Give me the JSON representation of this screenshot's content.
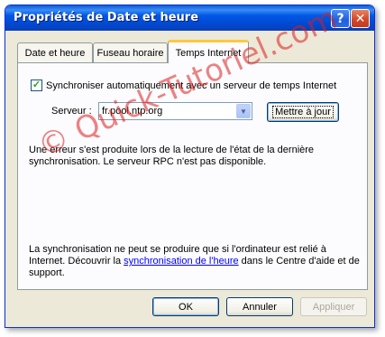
{
  "window": {
    "title": "Propriétés de Date et heure",
    "help_glyph": "?",
    "close_glyph": "✕"
  },
  "tabs": [
    {
      "label": "Date et heure"
    },
    {
      "label": "Fuseau horaire"
    },
    {
      "label": "Temps Internet"
    }
  ],
  "internet_time": {
    "sync_checkbox_label": "Synchroniser automatiquement avec un serveur de temps Internet",
    "sync_checked": true,
    "check_glyph": "✓",
    "server_label": "Serveur :",
    "server_value": "fr.pool.ntp.org",
    "dropdown_glyph": "▼",
    "update_button": "Mettre à jour",
    "error_text": "Une erreur s'est produite lors de la lecture de l'état de la dernière synchronisation. Le serveur RPC n'est pas disponible.",
    "info_before": "La synchronisation ne peut se produire que si l'ordinateur est relié à Internet. Découvrir la ",
    "info_link": "synchronisation de l'heure",
    "info_after": " dans le Centre d'aide et de support."
  },
  "buttons": {
    "ok": "OK",
    "cancel": "Annuler",
    "apply": "Appliquer"
  },
  "watermark": "© Quick-Tutoriel.com",
  "colors": {
    "titlebar": "#0058e6",
    "active_tab_accent": "#ffc83c",
    "watermark": "#dc1e1e"
  }
}
